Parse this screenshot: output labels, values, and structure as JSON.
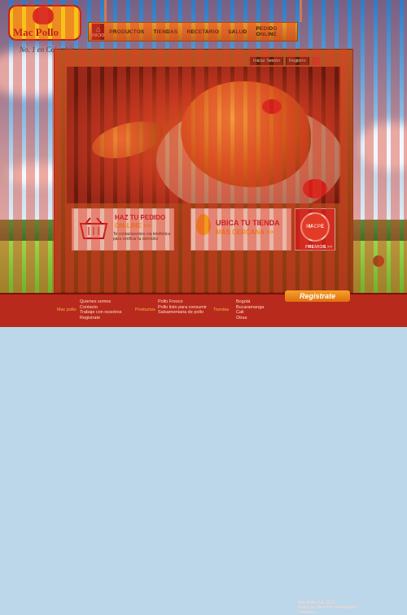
{
  "logo": {
    "brand": "Mac Pollo",
    "slogan": "No. 1 en Colombia"
  },
  "nav": {
    "home_label": "INICIO",
    "items": [
      {
        "label": "PRODUCTOS"
      },
      {
        "label": "TIENDAS"
      },
      {
        "label": "RECETARIO"
      },
      {
        "label": "SALUD"
      },
      {
        "label": "PEDIDO ONLINE"
      }
    ]
  },
  "utility": {
    "login_label": "Iniciar Sesión",
    "register_label": "Registro"
  },
  "promo_order": {
    "title": "HAZ TU PEDIDO",
    "subtitle": "ON-LINE >>",
    "text": "Te contactaremos vía telefónica para verificar tu domicilio"
  },
  "promo_store": {
    "title": "UBICA TU TIENDA",
    "subtitle": "MÁS CERCANA >>"
  },
  "promo_prizes": {
    "seal_text": "MACPE",
    "label": "PREMIOS >>"
  },
  "footer": {
    "mac_pollo": {
      "heading": "Mac pollo",
      "links": [
        "Quienes somos",
        "Contacto",
        "Trabaje con nosotros",
        "Registrate"
      ]
    },
    "productos": {
      "heading": "Productos",
      "links": [
        "Pollo Fresco",
        "Pollo listo para consumir",
        "Salsamentaria de pollo"
      ]
    },
    "tiendas": {
      "heading": "Tiendas",
      "links": [
        "Bogotá",
        "Bucaramanga",
        "Cali",
        "Otras"
      ]
    },
    "register_button": "Registrate",
    "copyright": [
      "Mac Pollo S.A. 2012",
      "Todos los Derechos Reservados",
      "Colombia"
    ]
  },
  "colors": {
    "brand_red": "#c01818",
    "brand_yellow": "#f6c21a",
    "wood": "#a8461a",
    "footer": "#b82a1c"
  }
}
